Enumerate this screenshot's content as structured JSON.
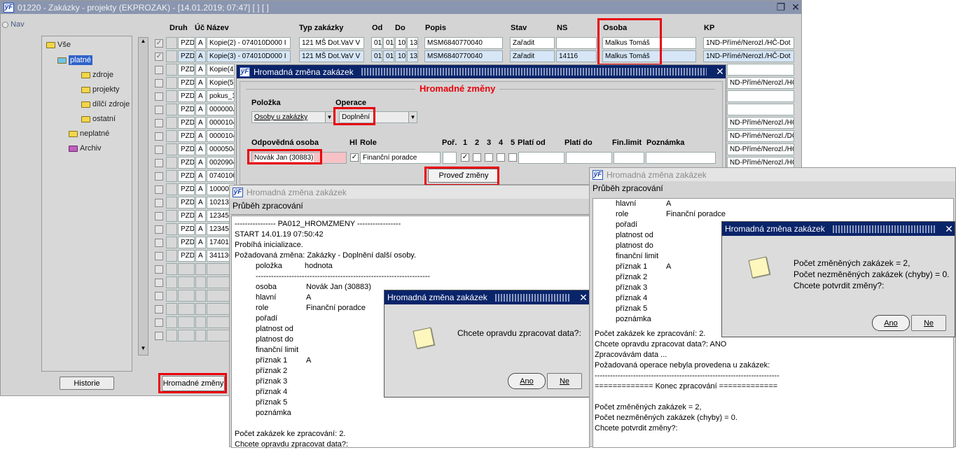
{
  "main_window": {
    "title": "01220 - Zakázky - projekty (EKPROZAK) - [14.01.2019; 07:47]  [ ]  [ ]",
    "nav_label": "Nav",
    "tree": [
      {
        "label": "Vše"
      },
      {
        "label": "platné"
      },
      {
        "label": "zdroje"
      },
      {
        "label": "projekty"
      },
      {
        "label": "dílčí zdroje"
      },
      {
        "label": "ostatní"
      },
      {
        "label": "neplatné"
      },
      {
        "label": "Archiv"
      }
    ],
    "columns": {
      "druh": "Druh",
      "uc": "Úč",
      "nazev": "Název",
      "typ": "Typ zakázky",
      "od": "Od",
      "do": "Do",
      "popis": "Popis",
      "stav": "Stav",
      "ns": "NS",
      "osoba": "Osoba",
      "kp": "KP"
    },
    "rows": [
      {
        "druh": "PZD",
        "uc": "A",
        "nazev": "Kopie(2) - 074010D000 I",
        "typ": "121 MŠ Dot.VaV V",
        "od1": "01",
        "od2": "01",
        "do1": "10",
        "do2": "13",
        "popis": "MSM6840770040",
        "stav": "Zařadit",
        "ns": "",
        "osoba": "Malkus Tomáš",
        "kp": "1ND-Přímé/Nerozl./HČ-Dot"
      },
      {
        "druh": "PZD",
        "uc": "A",
        "nazev": "Kopie(3) - 074010D000 I",
        "typ": "121 MŠ Dot.VaV V",
        "od1": "01",
        "od2": "01",
        "do1": "10",
        "do2": "13",
        "popis": "MSM6840770040",
        "stav": "Zařadit",
        "ns": "14116",
        "osoba": "Malkus Tomáš",
        "kp": "1ND-Přímé/Nerozl./HČ-Dot"
      },
      {
        "druh": "PZD",
        "uc": "A",
        "nazev": "Kopie(4)",
        "kp": ""
      },
      {
        "druh": "PZD",
        "uc": "A",
        "nazev": "Kopie(5)",
        "kp": "ND-Přímé/Nerozl./HČ-Dot"
      },
      {
        "druh": "PZD",
        "uc": "A",
        "nazev": "pokus_1",
        "kp": ""
      },
      {
        "druh": "PZD",
        "uc": "A",
        "nazev": "000000J",
        "kp": ""
      },
      {
        "druh": "PZD",
        "uc": "A",
        "nazev": "0000104",
        "kp": "ND-Přímé/Nerozl./HČ-Přís"
      },
      {
        "druh": "PZD",
        "uc": "A",
        "nazev": "0000104",
        "kp": "ND-Přímé/Nerozl./DČ-Eko"
      },
      {
        "druh": "PZD",
        "uc": "A",
        "nazev": "0000504",
        "kp": "ND-Přímé/Nerozl./HČ-Přís"
      },
      {
        "druh": "PZD",
        "uc": "A",
        "nazev": "0020904",
        "kp": "ND-Přímé/Nerozl./HČ-Přís"
      },
      {
        "druh": "PZD",
        "uc": "A",
        "nazev": "0740100",
        "kp": ""
      },
      {
        "druh": "PZD",
        "uc": "A",
        "nazev": "1000000",
        "kp": ""
      },
      {
        "druh": "PZD",
        "uc": "A",
        "nazev": "1021300",
        "kp": ""
      },
      {
        "druh": "PZD",
        "uc": "A",
        "nazev": "1234500",
        "kp": ""
      },
      {
        "druh": "PZD",
        "uc": "A",
        "nazev": "1234500",
        "kp": ""
      },
      {
        "druh": "PZD",
        "uc": "A",
        "nazev": "1740100",
        "kp": ""
      },
      {
        "druh": "PZD",
        "uc": "A",
        "nazev": "3411300",
        "kp": ""
      }
    ],
    "historie_button": "Historie",
    "hromadne_button": "Hromadné změny"
  },
  "dialog_hz": {
    "title": "Hromadná změna zakázek",
    "section_title": "Hromadné změny",
    "polozka_label": "Položka",
    "polozka_value": "Osoby u zakázky",
    "operace_label": "Operace",
    "operace_value": "Doplnění",
    "col_osoba": "Odpovědná osoba",
    "col_hl": "Hl",
    "col_role": "Role",
    "col_por": "Poř.",
    "col_1": "1",
    "col_2": "2",
    "col_3": "3",
    "col_4": "4",
    "col_5": "5",
    "col_plati_od": "Platí od",
    "col_plati_do": "Platí do",
    "col_fin": "Fin.limit",
    "col_poznamka": "Poznámka",
    "osoba_value": "Novák Jan (30883)",
    "role_value": "Finanční poradce",
    "proved_button": "Proveď změny"
  },
  "progress_left": {
    "title": "Hromadná změna zakázek",
    "heading": "Průběh zpracování",
    "lines": [
      "---------------- PA012_HROMZMENY -----------------",
      "START 14.01.19 07:50:42",
      "Probíhá inicializace.",
      "Požadovaná změna: Zakázky - Doplnění další osoby."
    ],
    "kv_header": {
      "k": "položka",
      "v": "hodnota"
    },
    "separator": "--------------------------------------------------------------------",
    "kv": [
      {
        "k": "osoba",
        "v": "Novák Jan (30883)"
      },
      {
        "k": "hlavní",
        "v": "A"
      },
      {
        "k": "role",
        "v": "Finanční poradce"
      },
      {
        "k": "pořadí",
        "v": ""
      },
      {
        "k": "platnost od",
        "v": ""
      },
      {
        "k": "platnost do",
        "v": ""
      },
      {
        "k": "finanční limit",
        "v": ""
      },
      {
        "k": "příznak 1",
        "v": "A"
      },
      {
        "k": "příznak 2",
        "v": ""
      },
      {
        "k": "příznak 3",
        "v": ""
      },
      {
        "k": "příznak 4",
        "v": ""
      },
      {
        "k": "příznak 5",
        "v": ""
      },
      {
        "k": "poznámka",
        "v": ""
      }
    ],
    "footer": [
      "Počet zakázek ke zpracování: 2.",
      "Chcete opravdu zpracovat data?:"
    ]
  },
  "confirm_left": {
    "title": "Hromadná změna zakázek",
    "message": "Chcete opravdu zpracovat data?:",
    "yes": "Ano",
    "no": "Ne"
  },
  "progress_right": {
    "title": "Hromadná změna zakázek",
    "heading": "Průběh zpracování",
    "kv": [
      {
        "k": "hlavní",
        "v": "A"
      },
      {
        "k": "role",
        "v": "Finanční poradce"
      },
      {
        "k": "pořadí",
        "v": ""
      },
      {
        "k": "platnost od",
        "v": ""
      },
      {
        "k": "platnost do",
        "v": ""
      },
      {
        "k": "finanční limit",
        "v": ""
      },
      {
        "k": "příznak 1",
        "v": "A"
      },
      {
        "k": "příznak 2",
        "v": ""
      },
      {
        "k": "příznak 3",
        "v": ""
      },
      {
        "k": "příznak 4",
        "v": ""
      },
      {
        "k": "příznak 5",
        "v": ""
      },
      {
        "k": "poznámka",
        "v": ""
      }
    ],
    "footer": [
      "Počet zakázek ke zpracování: 2.",
      "Chcete opravdu zpracovat data?: ANO",
      "Zpracovávám data ...",
      "Požadovaná operace nebyla provedena u zakázek:",
      "------------------------------------------------------------------------",
      "============= Konec zpracování =============",
      "",
      "Počet změněných zakázek = 2,",
      "Počet nezměněných zakázek (chyby) = 0.",
      "Chcete potvrdit změny?:"
    ]
  },
  "confirm_right": {
    "title": "Hromadná změna zakázek",
    "line1": "Počet změněných zakázek = 2,",
    "line2": "Počet nezměněných zakázek (chyby) = 0.",
    "line3": "Chcete potvrdit změny?:",
    "yes": "Ano",
    "no": "Ne"
  },
  "colors": {
    "titlebar": "#0a246a",
    "titlebar_inactive": "#8a96b0",
    "highlight": "#e8000b"
  }
}
